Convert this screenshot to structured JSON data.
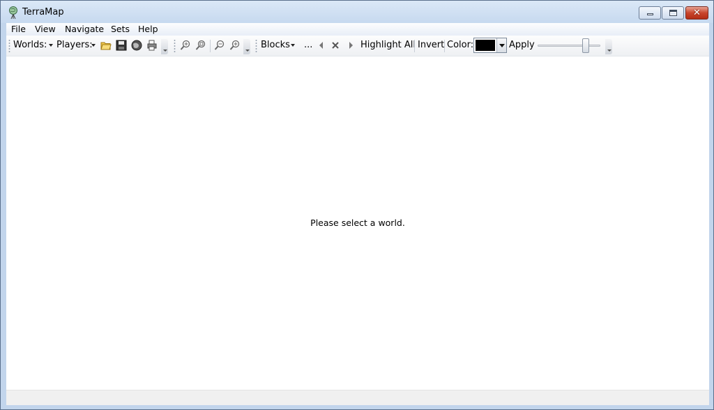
{
  "window": {
    "title": "TerraMap",
    "icon": "terramap-globe-icon",
    "controls": [
      "minimize-icon",
      "maximize-icon",
      "close-icon"
    ],
    "close_glyph": "✕"
  },
  "menu": {
    "file": "File",
    "view": "View",
    "navigate": "Navigate",
    "sets": "Sets",
    "help": "Help"
  },
  "toolbar": {
    "worlds_label": "Worlds:",
    "players_label": "Players:",
    "icons": [
      "open-folder-icon",
      "save-disk-icon",
      "globe-icon",
      "print-icon",
      "zoom-in-icon",
      "zoom-fit-icon",
      "zoom-out-icon",
      "zoom-reset-icon",
      "previous-arrow-icon",
      "clear-x-icon",
      "next-arrow-icon"
    ],
    "blocks_label": "Blocks",
    "ellipsis": "...",
    "highlight_all": "Highlight All",
    "invert": "Invert",
    "color_label": "Color:",
    "color_value": "#000000",
    "apply": "Apply",
    "slider_level": 0.8
  },
  "main": {
    "message": "Please select a world."
  },
  "colors": {
    "titlebar": "#c6d9ef",
    "close_button": "#c9462c",
    "background": "#ffffff"
  }
}
